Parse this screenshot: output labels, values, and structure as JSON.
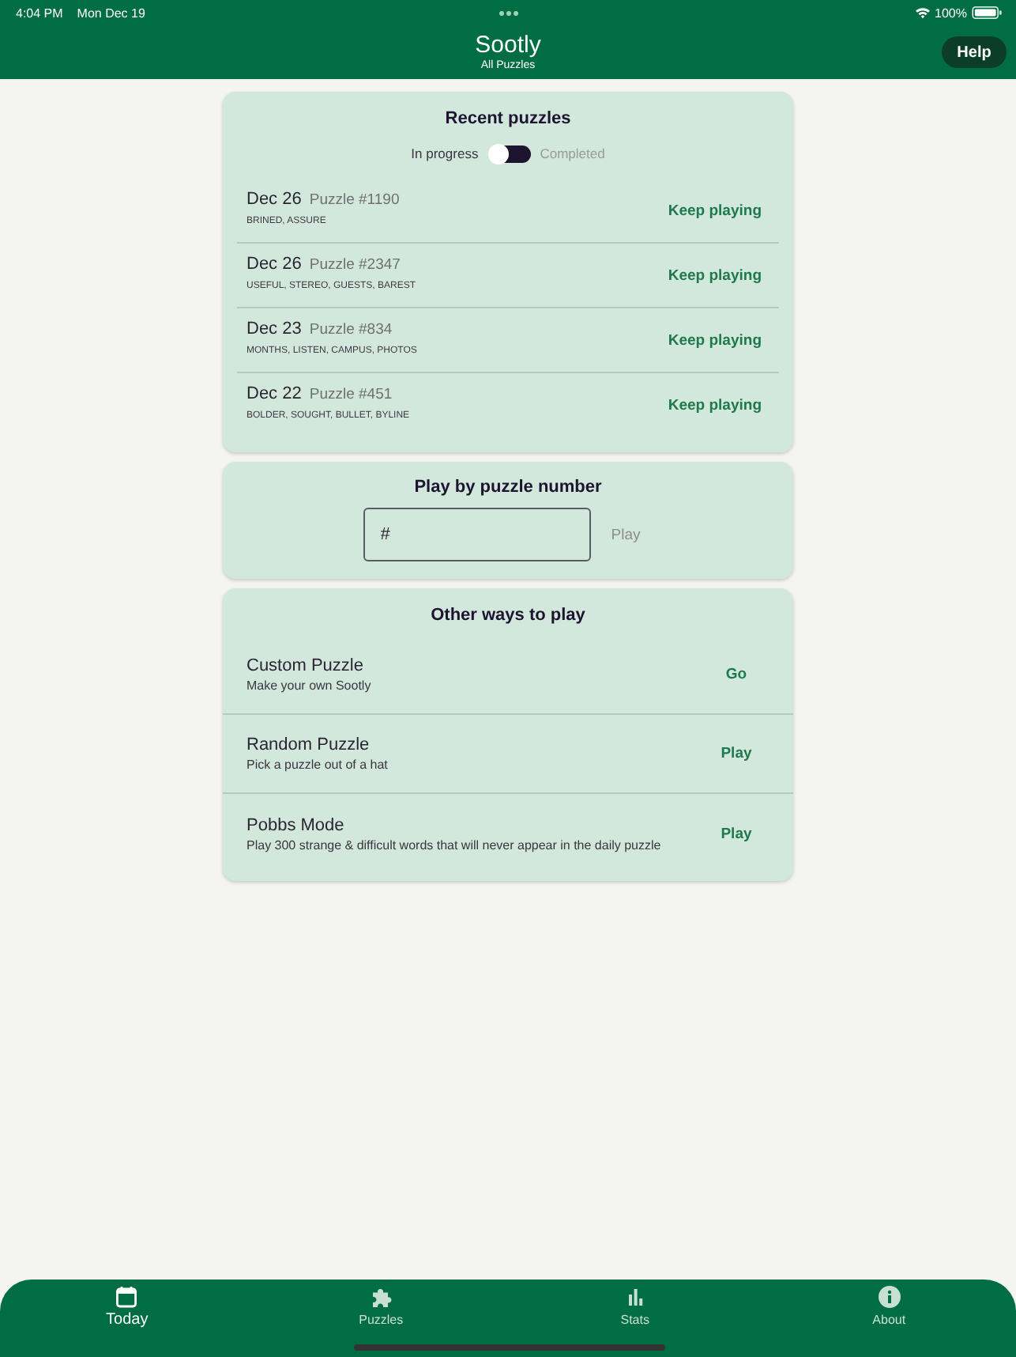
{
  "status_bar": {
    "time": "4:04 PM",
    "date": "Mon Dec 19",
    "battery": "100%"
  },
  "header": {
    "title": "Sootly",
    "subtitle": "All Puzzles",
    "help_button": "Help"
  },
  "recent_puzzles": {
    "title": "Recent puzzles",
    "filter": [
      {
        "label": "In progress",
        "selected": true
      },
      {
        "label": "Completed",
        "selected": false
      }
    ],
    "rows": [
      {
        "date": "Dec 26",
        "puzzle": "Puzzle #1190",
        "words": "BRINED, ASSURE",
        "action": "Keep playing"
      },
      {
        "date": "Dec 26",
        "puzzle": "Puzzle #2347",
        "words": "USEFUL, STEREO, GUESTS, BAREST",
        "action": "Keep playing"
      },
      {
        "date": "Dec 23",
        "puzzle": "Puzzle #834",
        "words": "MONTHS, LISTEN, CAMPUS, PHOTOS",
        "action": "Keep playing"
      },
      {
        "date": "Dec 22",
        "puzzle": "Puzzle #451",
        "words": "BOLDER, SOUGHT, BULLET, BYLINE",
        "action": "Keep playing"
      }
    ]
  },
  "play_by_number": {
    "title": "Play by puzzle number",
    "field": {
      "placeholder": "#"
    },
    "button": {
      "label": "Play",
      "disabled": true
    }
  },
  "other_ways": {
    "title": "Other ways to play",
    "items": [
      {
        "title": "Custom Puzzle",
        "subtitle": "Make your own Sootly",
        "action": "Go"
      },
      {
        "title": "Random Puzzle",
        "subtitle": "Pick a puzzle out of a hat",
        "action": "Play"
      },
      {
        "title": "Pobbs Mode",
        "subtitle": "Play 300 strange & difficult words that will never appear in the daily puzzle",
        "action": "Play"
      }
    ]
  },
  "tab_bar": [
    {
      "label": "Today",
      "selected": true
    },
    {
      "label": "Puzzles",
      "selected": false
    },
    {
      "label": "Stats",
      "selected": false
    },
    {
      "label": "About",
      "selected": false
    }
  ]
}
